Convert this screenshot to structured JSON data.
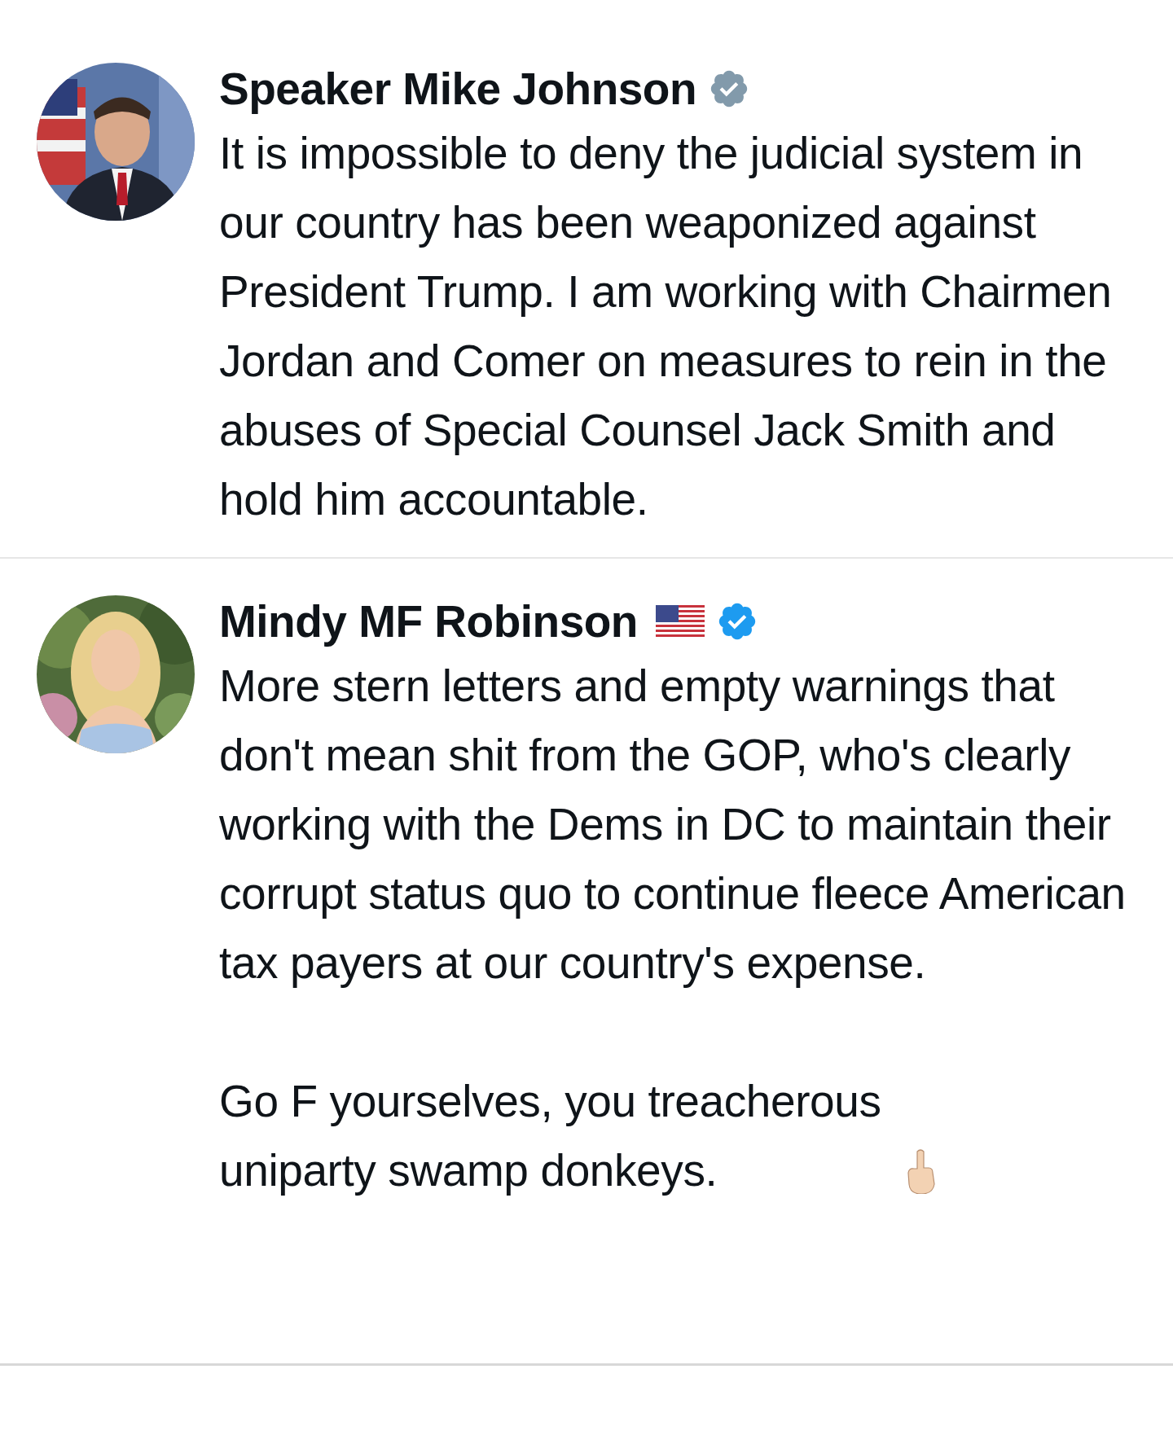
{
  "posts": [
    {
      "author": "Speaker Mike Johnson",
      "verified": true,
      "color": "#829aab",
      "flag": false,
      "paragraphs": [
        "It is impossible to deny the judicial system in our country has been weaponized against President Trump. I am working with Chairmen Jordan and Comer on measures to rein in the abuses of Special Counsel Jack Smith and hold him accountable."
      ],
      "hand_emoji": false
    },
    {
      "author": "Mindy MF Robinson",
      "verified": true,
      "color": "#1d9bf0",
      "flag": true,
      "paragraphs": [
        "More stern letters and empty warnings that don't mean shit from the GOP, who's clearly working with the Dems in DC to maintain their corrupt status quo to continue fleece American tax payers at our country's expense.",
        "Go F yourselves, you treacherous uniparty swamp donkeys."
      ],
      "hand_emoji": true
    }
  ]
}
